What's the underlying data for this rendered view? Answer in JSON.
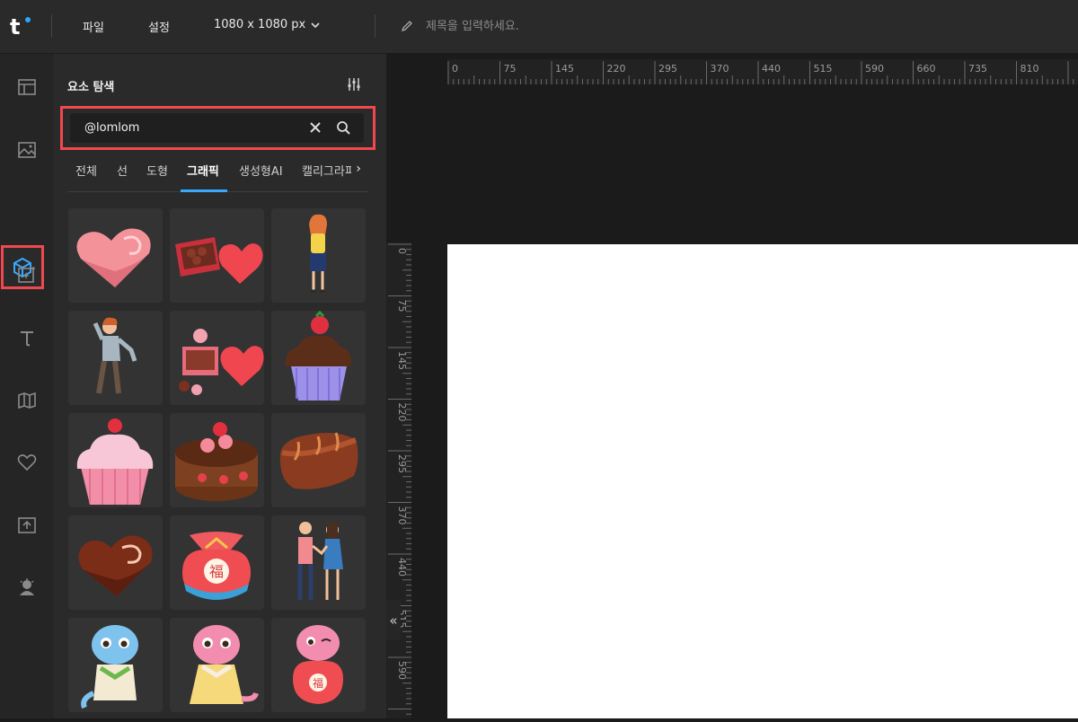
{
  "app": {
    "logo": "t"
  },
  "topbar": {
    "menu_file": "파일",
    "menu_settings": "설정",
    "canvas_size": "1080 x 1080 px",
    "title_placeholder": "제목을 입력하세요."
  },
  "sidebar": {
    "items": [
      {
        "icon": "template-icon"
      },
      {
        "icon": "image-icon"
      },
      {
        "icon": "elements-cube-icon",
        "active": true
      },
      {
        "icon": "ai-image-icon"
      },
      {
        "icon": "text-icon"
      },
      {
        "icon": "book-icon"
      },
      {
        "icon": "heart-icon"
      },
      {
        "icon": "upload-icon"
      },
      {
        "icon": "character-icon"
      }
    ]
  },
  "panel": {
    "title": "요소 탐색",
    "search_value": "@lomlom",
    "tabs": [
      "전체",
      "선",
      "도형",
      "그래픽",
      "생성형AI",
      "캘리그라피"
    ],
    "selected_tab": "그래픽",
    "items": [
      "heart-shaped pink candy",
      "heart gift box with chocolates",
      "woman standing illustration",
      "man waving illustration",
      "open heart chocolate box",
      "chocolate cupcake with strawberry",
      "pink cupcake with cherry",
      "chocolate cake with strawberries",
      "chocolate bonbon",
      "heart chocolate",
      "lucky pouch with 福",
      "couple holding hands",
      "blue snake character",
      "pink snake character",
      "pink snake with lucky pouch"
    ],
    "pouch_char": "福"
  },
  "ruler": {
    "top_ticks": [
      "0",
      "75",
      "145",
      "220",
      "295",
      "370",
      "440",
      "515",
      "590",
      "660",
      "735",
      "810"
    ],
    "left_ticks": [
      "0",
      "75",
      "145",
      "220",
      "295",
      "370",
      "440",
      "515",
      "590"
    ]
  },
  "colors": {
    "accent": "#39a8ff",
    "highlight": "#f0484f",
    "artboard": "#ffffff"
  }
}
